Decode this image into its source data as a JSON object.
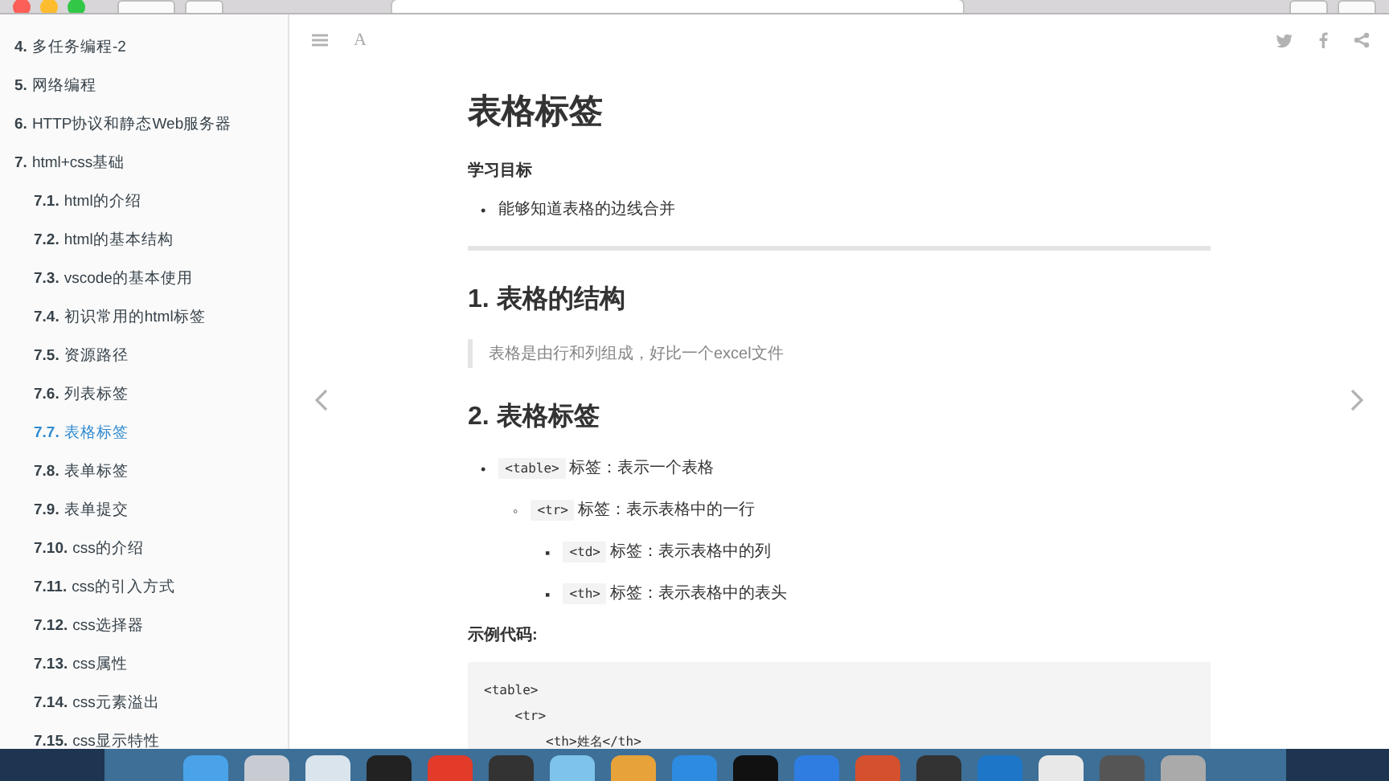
{
  "sidebar": {
    "items": [
      {
        "number": "4.",
        "title": "多任务编程-2",
        "selected": false
      },
      {
        "number": "5.",
        "title": "网络编程",
        "selected": false
      },
      {
        "number": "6.",
        "title": "HTTP协议和静态Web服务器",
        "selected": false
      },
      {
        "number": "7.",
        "title": "html+css基础",
        "selected": false,
        "children": [
          {
            "number": "7.1.",
            "title": "html的介绍",
            "selected": false
          },
          {
            "number": "7.2.",
            "title": "html的基本结构",
            "selected": false
          },
          {
            "number": "7.3.",
            "title": "vscode的基本使用",
            "selected": false
          },
          {
            "number": "7.4.",
            "title": "初识常用的html标签",
            "selected": false
          },
          {
            "number": "7.5.",
            "title": "资源路径",
            "selected": false
          },
          {
            "number": "7.6.",
            "title": "列表标签",
            "selected": false
          },
          {
            "number": "7.7.",
            "title": "表格标签",
            "selected": true
          },
          {
            "number": "7.8.",
            "title": "表单标签",
            "selected": false
          },
          {
            "number": "7.9.",
            "title": "表单提交",
            "selected": false
          },
          {
            "number": "7.10.",
            "title": "css的介绍",
            "selected": false
          },
          {
            "number": "7.11.",
            "title": "css的引入方式",
            "selected": false
          },
          {
            "number": "7.12.",
            "title": "css选择器",
            "selected": false
          },
          {
            "number": "7.13.",
            "title": "css属性",
            "selected": false
          },
          {
            "number": "7.14.",
            "title": "css元素溢出",
            "selected": false
          },
          {
            "number": "7.15.",
            "title": "css显示特性",
            "selected": false
          }
        ]
      }
    ]
  },
  "toolbar": {
    "font_button": "A"
  },
  "article": {
    "title": "表格标签",
    "goal_heading": "学习目标",
    "goals": [
      {
        "marker": "•",
        "text": "能够知道表格的边线合并"
      }
    ],
    "sections": [
      {
        "heading": "1. 表格的结构",
        "quote": "表格是由行和列组成，好比一个excel文件"
      },
      {
        "heading": "2. 表格标签",
        "list": [
          {
            "marker": "•",
            "code": "<table>",
            "text": "标签：表示一个表格",
            "children": [
              {
                "marker": "◦",
                "code": "<tr>",
                "text": "标签：表示表格中的一行",
                "children": [
                  {
                    "marker": "▪",
                    "code": "<td>",
                    "text": "标签：表示表格中的列"
                  },
                  {
                    "marker": "▪",
                    "code": "<th>",
                    "text": "标签：表示表格中的表头"
                  }
                ]
              }
            ]
          }
        ],
        "example_heading": "示例代码:",
        "code_lines": [
          "<table>",
          "    <tr>",
          "        <th>姓名</th>"
        ]
      }
    ]
  }
}
